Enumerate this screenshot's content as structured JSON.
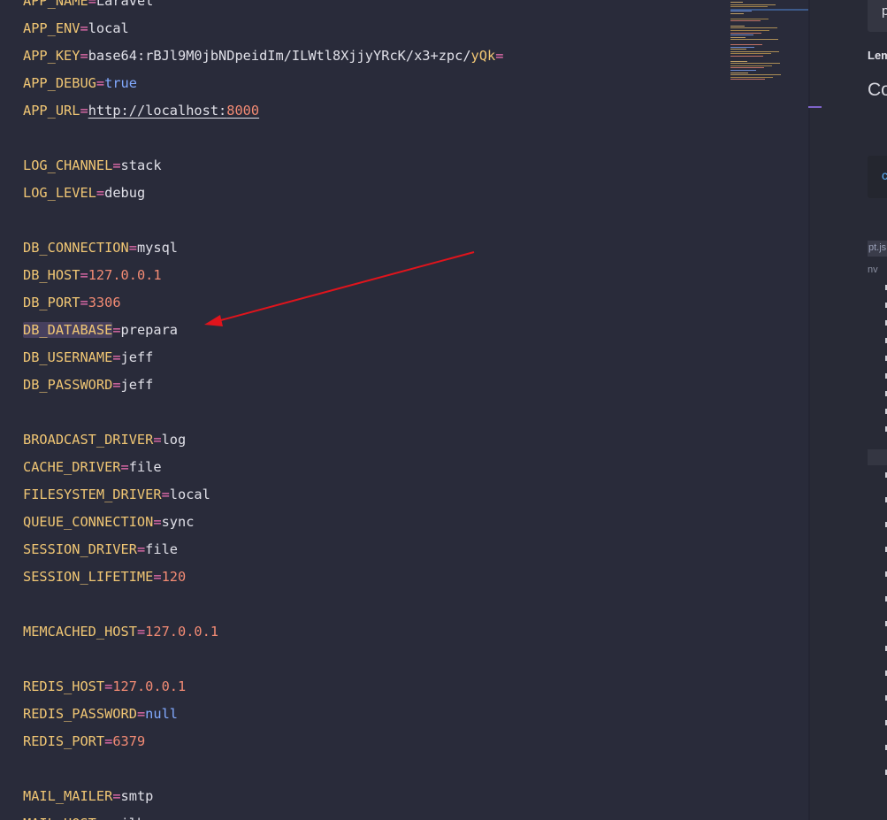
{
  "editor": {
    "lines": [
      {
        "key": "APP_NAME",
        "value": "Laravel",
        "vtype": "str"
      },
      {
        "key": "APP_ENV",
        "value": "local",
        "vtype": "str"
      },
      {
        "key": "APP_KEY",
        "value": "base64:rBJl9M0jbNDpeidIm/ILWtl8XjjyYRcK/x3+zpc/",
        "value_tail": "yQk",
        "tail_suffix": "=",
        "vtype": "key"
      },
      {
        "key": "APP_DEBUG",
        "value": "true",
        "vtype": "kw"
      },
      {
        "key": "APP_URL",
        "value": "http://localhost:",
        "value_tail": "8000",
        "vtype": "url"
      },
      {
        "blank": true
      },
      {
        "key": "LOG_CHANNEL",
        "value": "stack",
        "vtype": "str"
      },
      {
        "key": "LOG_LEVEL",
        "value": "debug",
        "vtype": "str"
      },
      {
        "blank": true
      },
      {
        "key": "DB_CONNECTION",
        "value": "mysql",
        "vtype": "str"
      },
      {
        "key": "DB_HOST",
        "value": "127.0.0.1",
        "vtype": "num"
      },
      {
        "key": "DB_PORT",
        "value": "3306",
        "vtype": "num"
      },
      {
        "key": "DB_DATABASE",
        "value": "prepara",
        "vtype": "str",
        "selected": true
      },
      {
        "key": "DB_USERNAME",
        "value": "jeff",
        "vtype": "str"
      },
      {
        "key": "DB_PASSWORD",
        "value": "jeff",
        "vtype": "str"
      },
      {
        "blank": true
      },
      {
        "key": "BROADCAST_DRIVER",
        "value": "log",
        "vtype": "str"
      },
      {
        "key": "CACHE_DRIVER",
        "value": "file",
        "vtype": "str"
      },
      {
        "key": "FILESYSTEM_DRIVER",
        "value": "local",
        "vtype": "str"
      },
      {
        "key": "QUEUE_CONNECTION",
        "value": "sync",
        "vtype": "str"
      },
      {
        "key": "SESSION_DRIVER",
        "value": "file",
        "vtype": "str"
      },
      {
        "key": "SESSION_LIFETIME",
        "value": "120",
        "vtype": "num"
      },
      {
        "blank": true
      },
      {
        "key": "MEMCACHED_HOST",
        "value": "127.0.0.1",
        "vtype": "num"
      },
      {
        "blank": true
      },
      {
        "key": "REDIS_HOST",
        "value": "127.0.0.1",
        "vtype": "num"
      },
      {
        "key": "REDIS_PASSWORD",
        "value": "null",
        "vtype": "kw"
      },
      {
        "key": "REDIS_PORT",
        "value": "6379",
        "vtype": "num"
      },
      {
        "blank": true
      },
      {
        "key": "MAIL_MAILER",
        "value": "smtp",
        "vtype": "str"
      },
      {
        "key": "MAIL_HOST",
        "value": "mailhog",
        "vtype": "str"
      }
    ],
    "operator": "="
  },
  "side_panel": {
    "items": [
      {
        "text": "p"
      },
      {
        "text": "Lem"
      },
      {
        "text": "Co"
      },
      {
        "text": "c"
      },
      {
        "text": "pt.js"
      },
      {
        "text": "nv"
      }
    ]
  },
  "colors": {
    "editor_bg": "#292b3a",
    "key": "#f0c674",
    "operator": "#f472b6",
    "number": "#f38b74",
    "keyword": "#82aaff",
    "selection": "#47405e",
    "annotation_arrow": "#e0141c",
    "scroll_thumb": "#7e63c9"
  },
  "annotation": {
    "type": "arrow",
    "target": "DB_DATABASE",
    "color": "#e0141c"
  }
}
